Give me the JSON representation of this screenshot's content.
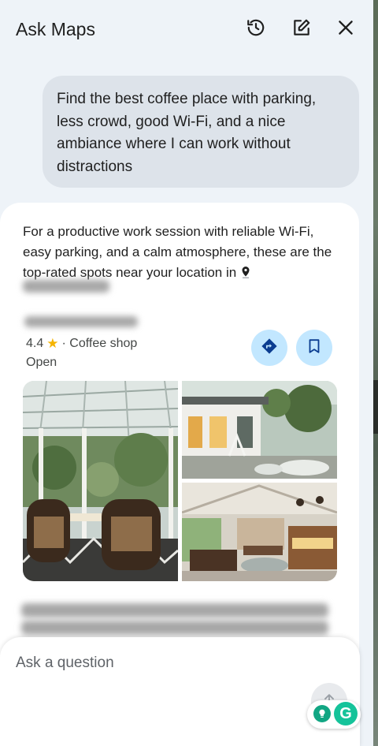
{
  "header": {
    "title": "Ask Maps",
    "icons": [
      "history-icon",
      "edit-icon",
      "close-icon"
    ]
  },
  "user_message": "Find the best coffee place with parking, less crowd, good Wi-Fi, and a nice ambiance where I can work without distractions",
  "answer": {
    "intro_text": "For a productive work session with reliable Wi-Fi, easy parking, and a calm atmosphere, these are the top-rated spots near your location in",
    "place": {
      "rating": "4.4",
      "category": "· Coffee shop",
      "status": "Open"
    }
  },
  "ask_box": {
    "placeholder": "Ask a question"
  },
  "colors": {
    "panel_bg": "#eef3f8",
    "bubble_bg": "#dde3ea",
    "action_btn_bg": "#c2e7ff",
    "accent": "#0b57d0",
    "star": "#f5b400"
  }
}
